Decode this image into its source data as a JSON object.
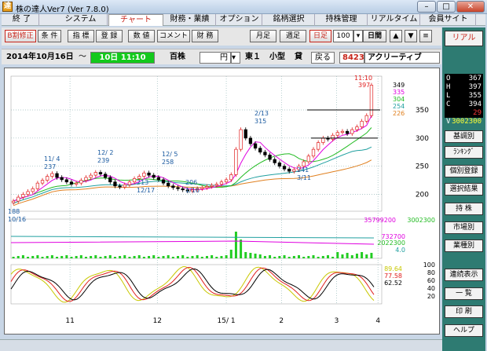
{
  "window": {
    "title": "株の達人Ver7 (Ver 7.8.0)",
    "app_icon": "達"
  },
  "menu": [
    {
      "label": "終 了"
    },
    {
      "label": "システム"
    },
    {
      "label": "チャート",
      "active": true
    },
    {
      "label": "財務・業績"
    },
    {
      "label": "オプション"
    },
    {
      "label": "銘柄選択"
    },
    {
      "label": "持株管理"
    },
    {
      "label": "リアルタイム"
    },
    {
      "label": "会員サイト"
    }
  ],
  "toolbar": {
    "buttons": [
      "B割修正",
      "条 件",
      "指 標",
      "登 録",
      "数 値",
      "コメント",
      "財 務"
    ],
    "period_buttons": [
      "月足",
      "週足",
      "日足"
    ],
    "count": "100",
    "count_unit": "日間",
    "up": "▲",
    "down": "▼",
    "menu_icon": "≡"
  },
  "info": {
    "date": "2014年10月16日",
    "tilde": "～",
    "end_date": "10日 11:10",
    "unit_label": "百株",
    "currency": "円",
    "market": "東１",
    "size": "小型",
    "loan": "貸",
    "back_button": "戻る",
    "code": "8423",
    "name": "アクリーティブ"
  },
  "sidebar": {
    "top_button": "リアル",
    "quote": {
      "O": "367",
      "H": "397",
      "L": "355",
      "C": "394",
      "change": "29",
      "V": "3002300"
    },
    "buttons": [
      "基調別",
      "ﾗﾝｷﾝｸﾞ",
      "個別登録",
      "選択結果",
      "持 株",
      "市場別",
      "業種別",
      "連続表示",
      "一 覧",
      "印 刷",
      "ヘルプ"
    ]
  },
  "colors": {
    "candle_up": "#e02020",
    "candle_down": "#000000",
    "ma_short": "#e000e0",
    "ma_mid": "#22bb22",
    "ma_long": "#20a0a0",
    "ma_xlong": "#e08020",
    "volume": "#22cc22",
    "stoch_k": "#e02020",
    "stoch_d": "#000000",
    "stoch_slow": "#c8c800"
  },
  "chart_data": [
    {
      "type": "candlestick",
      "title": "",
      "y_ticks": [
        200,
        250,
        300,
        350
      ],
      "ylim": [
        170,
        410
      ],
      "x_ticks": [
        "11",
        "12",
        "15/ 1",
        "2",
        "3",
        "4"
      ],
      "latest": {
        "time": "11:10",
        "close": "397",
        "ma_short": "349",
        "ma_mid": "335",
        "ma_long": "304",
        "ma_xlong": "254",
        "ma_xxlong": "226"
      },
      "annotations": [
        {
          "label": "188",
          "sub": "10/16"
        },
        {
          "label": "11/ 4",
          "sub": "237"
        },
        {
          "label": "12/ 2",
          "sub": "239"
        },
        {
          "label": "213",
          "sub": "12/17"
        },
        {
          "label": "12/ 5",
          "sub": "258"
        },
        {
          "label": "206",
          "sub": "1/16"
        },
        {
          "label": "2/13",
          "sub": "315"
        },
        {
          "label": "241",
          "sub": "3/11"
        }
      ],
      "closes": [
        188,
        195,
        200,
        205,
        210,
        220,
        225,
        232,
        237,
        230,
        226,
        222,
        218,
        220,
        225,
        230,
        234,
        239,
        236,
        230,
        222,
        215,
        213,
        217,
        222,
        228,
        232,
        238,
        234,
        230,
        226,
        220,
        215,
        212,
        210,
        208,
        206,
        208,
        210,
        212,
        214,
        216,
        218,
        222,
        226,
        235,
        280,
        315,
        300,
        290,
        282,
        275,
        270,
        262,
        256,
        250,
        245,
        241,
        244,
        250,
        258,
        268,
        280,
        292,
        300,
        298,
        305,
        310,
        312,
        308,
        315,
        320,
        330,
        340,
        394
      ]
    },
    {
      "type": "bar",
      "title": "volume",
      "labels": [
        "35799200",
        "3002300",
        "732700",
        "2022300",
        "4.0"
      ]
    },
    {
      "type": "line",
      "title": "stochastics",
      "y_ticks": [
        20,
        40,
        60,
        80,
        100
      ],
      "ylim": [
        0,
        100
      ],
      "labels": [
        "89.64",
        "77.58",
        "62.52"
      ]
    }
  ]
}
